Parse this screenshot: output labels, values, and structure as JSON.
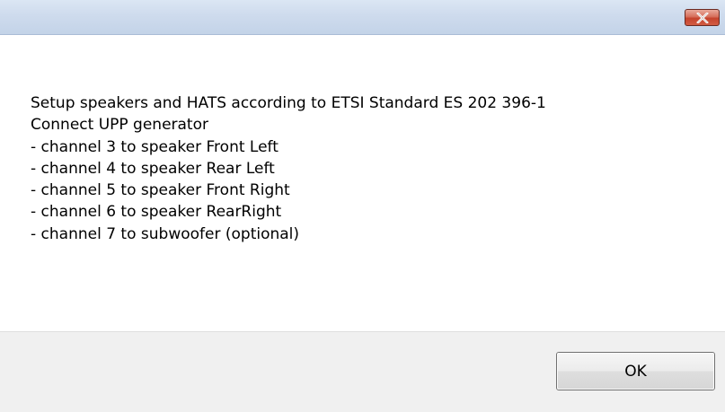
{
  "dialog": {
    "close_icon": "close-icon",
    "message_lines": [
      "Setup speakers and HATS according to ETSI Standard ES 202 396-1",
      "Connect UPP generator",
      "- channel 3 to speaker Front Left",
      "- channel 4 to speaker Rear Left",
      "- channel 5 to speaker Front Right",
      "- channel 6 to speaker RearRight",
      "- channel 7 to subwoofer (optional)"
    ],
    "ok_label": "OK"
  },
  "colors": {
    "titlebar": "#cedbed",
    "close_button": "#c5432d",
    "footer": "#f0f0f0"
  }
}
